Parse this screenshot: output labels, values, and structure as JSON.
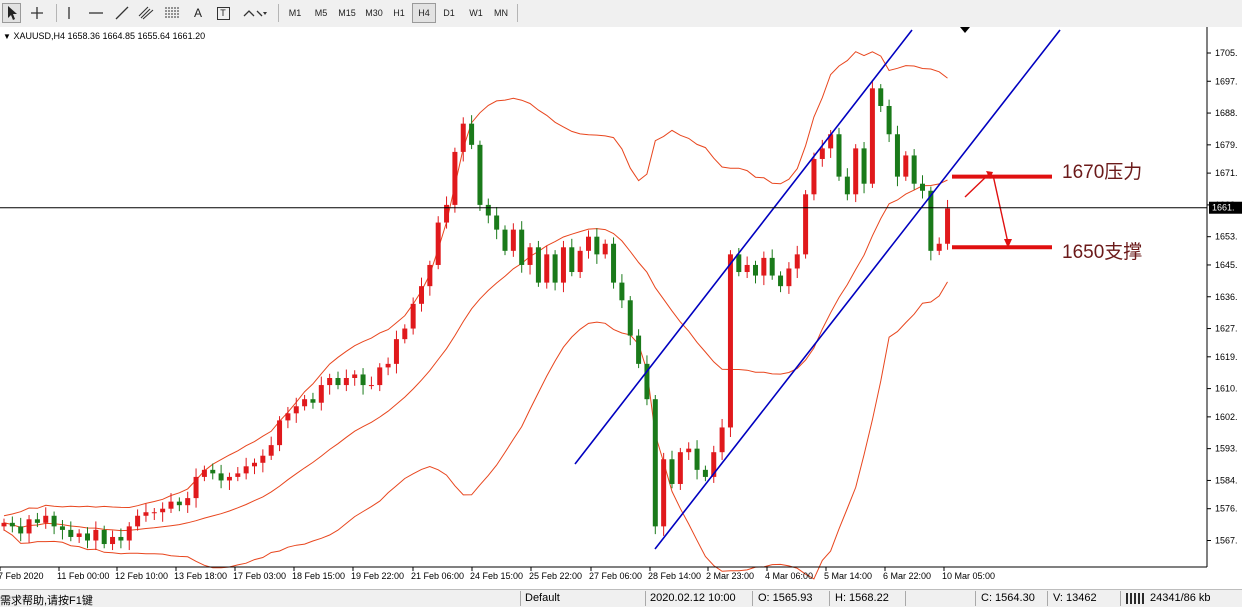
{
  "toolbar": {
    "timeframes": [
      "M1",
      "M5",
      "M15",
      "M30",
      "H1",
      "H4",
      "D1",
      "W1",
      "MN"
    ],
    "active_timeframe": "H4",
    "tools": [
      "cursor-icon",
      "crosshair-icon",
      "vertical-line-icon",
      "horizontal-line-icon",
      "trendline-icon",
      "channel-icon",
      "fibonacci-icon",
      "text-icon",
      "label-icon",
      "arrows-icon"
    ],
    "text_tool_glyph": "A",
    "label_tool_glyph": "T"
  },
  "chart_header": {
    "symbol_line": "XAUUSD,H4  1658.36 1664.85 1655.64 1661.20"
  },
  "status_bar": {
    "help_text": "需求帮助,请按F1键",
    "profile": "Default",
    "datetime": "2020.02.12 10:00",
    "open": "O: 1565.93",
    "high": "H: 1568.22",
    "close": "C: 1564.30",
    "volume": "V: 13462",
    "traffic": "24341/86 kb"
  },
  "annotations": {
    "resistance_label": "1670压力",
    "support_label": "1650支撑"
  },
  "colors": {
    "bull_candle": "#e0191c",
    "bear_candle": "#1a7a1a",
    "bollinger": "#e8461e",
    "channel": "#0000c0",
    "annotation_line": "#e01010"
  },
  "chart_data": {
    "type": "candlestick",
    "symbol": "XAUUSD",
    "timeframe": "H4",
    "ylim": [
      1560,
      1710
    ],
    "y_ticks": [
      1567,
      1576,
      1584,
      1593,
      1602,
      1610,
      1619,
      1627,
      1636,
      1645,
      1653,
      1662,
      1671,
      1679,
      1688,
      1697,
      1705
    ],
    "y_tick_labels": [
      "1567.",
      "1576.",
      "1584.",
      "1593.",
      "1602.",
      "1610.",
      "1619.",
      "1627.",
      "1636.",
      "1645.",
      "1653.",
      "1662.",
      "1671.",
      "1679.",
      "1688.",
      "1697.",
      "1705."
    ],
    "current_price_label": "1661.",
    "current_price": 1661.2,
    "x_labels": [
      "7 Feb 2020",
      "11 Feb 00:00",
      "12 Feb 10:00",
      "13 Feb 18:00",
      "17 Feb 03:00",
      "18 Feb 15:00",
      "19 Feb 22:00",
      "21 Feb 06:00",
      "24 Feb 15:00",
      "25 Feb 22:00",
      "27 Feb 06:00",
      "28 Feb 14:00",
      "2 Mar 23:00",
      "4 Mar 06:00",
      "5 Mar 14:00",
      "6 Mar 22:00",
      "10 Mar 05:00"
    ],
    "candle_closes": [
      1572,
      1571,
      1569,
      1573,
      1572,
      1574,
      1571,
      1570,
      1568,
      1569,
      1567,
      1570,
      1566,
      1568,
      1567,
      1571,
      1574,
      1575,
      1575,
      1576,
      1578,
      1577,
      1579,
      1585,
      1587,
      1586,
      1584,
      1585,
      1586,
      1588,
      1589,
      1591,
      1594,
      1601,
      1603,
      1605,
      1607,
      1606,
      1611,
      1613,
      1611,
      1613,
      1614,
      1611,
      1611,
      1616,
      1617,
      1624,
      1627,
      1634,
      1639,
      1645,
      1657,
      1662,
      1677,
      1685,
      1679,
      1662,
      1659,
      1655,
      1649,
      1655,
      1645,
      1650,
      1640,
      1648,
      1640,
      1650,
      1643,
      1649,
      1653,
      1648,
      1651,
      1640,
      1635,
      1625,
      1617,
      1607,
      1571,
      1590,
      1583,
      1592,
      1593,
      1587,
      1585,
      1592,
      1599,
      1648,
      1643,
      1645,
      1642,
      1647,
      1642,
      1639,
      1644,
      1648,
      1665,
      1675,
      1678,
      1682,
      1670,
      1665,
      1678,
      1668,
      1695,
      1690,
      1682,
      1670,
      1676,
      1668,
      1666,
      1649,
      1651,
      1661
    ]
  }
}
